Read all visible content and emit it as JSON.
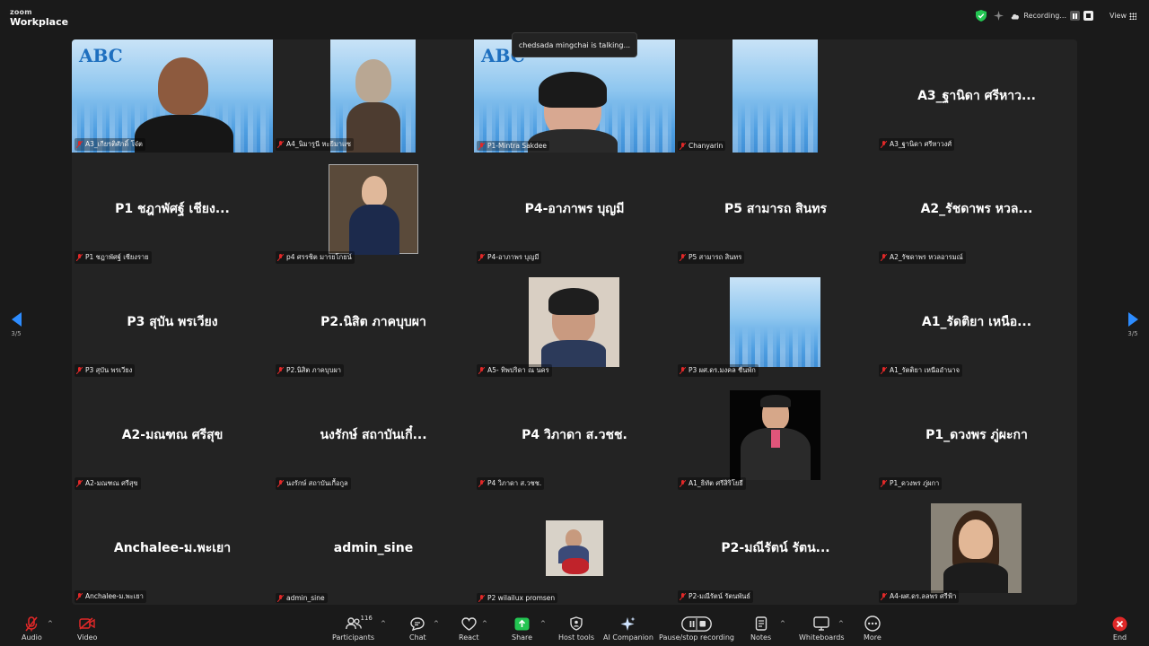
{
  "app": {
    "brand_top": "zoom",
    "brand_bottom": "Workplace"
  },
  "topbar": {
    "recording_label": "Recording...",
    "view_label": "View"
  },
  "speaker_notice": "chedsada mingchai is talking...",
  "page_indicator": "3/5",
  "colors": {
    "accent": "#2d8cff",
    "mic_off": "#e02828",
    "tile_bg": "#232323",
    "shield": "#23c552"
  },
  "tiles": [
    {
      "display_name": "",
      "label": "A3_เกียรติศักดิ์ โจ๋ต"
    },
    {
      "display_name": "",
      "label": "A4_นิมารูนี หะยีมาแซ"
    },
    {
      "display_name": "",
      "label": "P1-Mintra Sakdee"
    },
    {
      "display_name": "",
      "label": "Chanyarin"
    },
    {
      "display_name": "A3_ฐานิดา ศรีหาว...",
      "label": "A3_ฐานิดา ศรีหาวงศ์"
    },
    {
      "display_name": "P1 ชฎาพัศฐ์ เชียง...",
      "label": "P1 ชฎาพัศฐ์ เชียงราย"
    },
    {
      "display_name": "",
      "label": "p4 ศรรชิต มารยโกยน์"
    },
    {
      "display_name": "P4-อาภาพร บุญมี",
      "label": "P4-อาภาพร บุญมี"
    },
    {
      "display_name": "P5 สามารถ สินทร",
      "label": "P5 สามารถ สินทร"
    },
    {
      "display_name": "A2_รัชดาพร หวล...",
      "label": "A2_รัชดาพร หวลอารมณ์"
    },
    {
      "display_name": "P3 สุบัน พรเวียง",
      "label": "P3 สุบัน พรเวียง"
    },
    {
      "display_name": "P2.นิสิต ภาคบุบผา",
      "label": "P2.นิสิต ภาคบุบผา"
    },
    {
      "display_name": "",
      "label": "A5- ทิพปริดา ณ นคร"
    },
    {
      "display_name": "",
      "label": "P3 ผศ.ดร.มงคล ชื่นพัก"
    },
    {
      "display_name": "A1_รัดติยา เหนือ...",
      "label": "A1_รัตติยา เหนืออำนาจ"
    },
    {
      "display_name": "A2-มณฑณ ศรีสุข",
      "label": "A2-มณฑณ ศรีสุข"
    },
    {
      "display_name": "นงรักษ์ สถาบันเกี๋...",
      "label": "นงรักษ์ สถาบันเกื้อกูล"
    },
    {
      "display_name": "P4 วิภาดา ส.วชช.",
      "label": "P4 วิภาดา ส.วชช."
    },
    {
      "display_name": "",
      "label": "A1_ธิทัต ศรีสิริโยธี"
    },
    {
      "display_name": "P1_ดวงพร ภู่ผะกา",
      "label": "P1_ดวงพร ภู่ผกา"
    },
    {
      "display_name": "Anchalee-ม.พะเยา",
      "label": "Anchalee-ม.พะเยา"
    },
    {
      "display_name": "admin_sine",
      "label": "admin_sine"
    },
    {
      "display_name": "",
      "label": "P2 wilailux promsen"
    },
    {
      "display_name": "P2-มณีรัตน์ รัตน...",
      "label": "P2-มณีรัตน์ รัตนพันธ์"
    },
    {
      "display_name": "",
      "label": "A4-ผศ.ดร.ลลพร ศรีฟ้า"
    }
  ],
  "toolbar": {
    "audio": "Audio",
    "video": "Video",
    "participants": "Participants",
    "participants_count": "116",
    "chat": "Chat",
    "react": "React",
    "share": "Share",
    "host_tools": "Host tools",
    "ai_companion": "AI Companion",
    "pause_recording": "Pause/stop recording",
    "notes": "Notes",
    "whiteboards": "Whiteboards",
    "more": "More",
    "end": "End"
  }
}
